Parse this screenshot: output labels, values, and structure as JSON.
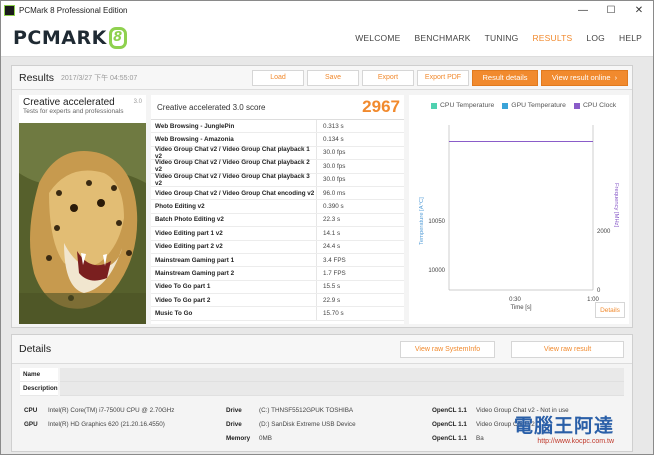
{
  "window": {
    "title": "PCMark 8 Professional Edition",
    "minimize_glyph": "—",
    "maximize_glyph": "☐",
    "close_glyph": "✕"
  },
  "nav": {
    "logo_text": "PCMARK",
    "logo_badge": "8",
    "links": [
      "WELCOME",
      "BENCHMARK",
      "TUNING",
      "RESULTS",
      "LOG",
      "HELP"
    ],
    "active": "RESULTS"
  },
  "results": {
    "heading": "Results",
    "date": "2017/3/27 下午 04:55:07",
    "buttons": {
      "load": "Load",
      "save": "Save",
      "export": "Export",
      "export_pdf": "Export PDF",
      "result_details": "Result details",
      "view_online": "View result online"
    }
  },
  "test": {
    "name": "Creative accelerated",
    "version": "3.0",
    "description": "Tests for experts and professionals"
  },
  "score": {
    "label": "Creative accelerated 3.0 score",
    "value": "2967",
    "rows": [
      {
        "label": "Web Browsing - JunglePin",
        "value": "0.313 s"
      },
      {
        "label": "Web Browsing - Amazonia",
        "value": "0.134 s"
      },
      {
        "label": "Video Group Chat v2 / Video Group Chat playback 1 v2",
        "value": "30.0 fps"
      },
      {
        "label": "Video Group Chat v2 / Video Group Chat playback 2 v2",
        "value": "30.0 fps"
      },
      {
        "label": "Video Group Chat v2 / Video Group Chat playback 3 v2",
        "value": "30.0 fps"
      },
      {
        "label": "Video Group Chat v2 / Video Group Chat encoding v2",
        "value": "96.0 ms"
      },
      {
        "label": "Photo Editing v2",
        "value": "0.390 s"
      },
      {
        "label": "Batch Photo Editing v2",
        "value": "22.3 s"
      },
      {
        "label": "Video Editing part 1 v2",
        "value": "14.1 s"
      },
      {
        "label": "Video Editing part 2 v2",
        "value": "24.4 s"
      },
      {
        "label": "Mainstream Gaming part 1",
        "value": "3.4 FPS"
      },
      {
        "label": "Mainstream Gaming part 2",
        "value": "1.7 FPS"
      },
      {
        "label": "Video To Go part 1",
        "value": "15.5 s"
      },
      {
        "label": "Video To Go part 2",
        "value": "22.9 s"
      },
      {
        "label": "Music To Go",
        "value": "15.70 s"
      }
    ]
  },
  "monitor": {
    "legend": [
      {
        "name": "CPU Temperature",
        "color": "#4fd1b0"
      },
      {
        "name": "GPU Temperature",
        "color": "#3aa3d8"
      },
      {
        "name": "CPU Clock",
        "color": "#8a5cc9"
      }
    ],
    "left_axis_label": "Temperature [A°C]",
    "right_axis_label": "Frequency [MHz]",
    "left_ticks": [
      "10050",
      "10000"
    ],
    "right_ticks": [
      "2000",
      "0"
    ],
    "x_ticks": [
      "0:30",
      "1:00"
    ],
    "x_label": "Time [s]",
    "details_button": "Details"
  },
  "chart_data": {
    "type": "line",
    "x": [
      0,
      60
    ],
    "series": [
      {
        "name": "CPU Clock",
        "values": [
          2700,
          2700
        ]
      }
    ],
    "xlabel": "Time [s]",
    "ylabel": "Temperature [A°C]",
    "y2label": "Frequency [MHz]",
    "ylim": [
      9950,
      10100
    ],
    "y2lim": [
      0,
      3000
    ],
    "xlim": [
      0,
      60
    ],
    "grid": false
  },
  "details": {
    "heading": "Details",
    "view_sysinfo": "View raw SystemInfo",
    "view_result": "View raw result",
    "name_label": "Name",
    "description_label": "Description",
    "cpu_label": "CPU",
    "cpu_value": "Intel(R) Core(TM) i7-7500U CPU @ 2.70GHz",
    "gpu_label": "GPU",
    "gpu_value": "Intel(R) HD Graphics 620 (21.20.16.4550)",
    "drive_label": "Drive",
    "drive1_value": "(C:) THNSF5512GPUK TOSHIBA",
    "drive2_value": "(D:) SanDisk Extreme USB Device",
    "memory_label": "Memory",
    "memory_value": "0MB",
    "opencl_label": "OpenCL 1.1",
    "opencl1_value": "Video Group Chat v2 - Not in use",
    "opencl2_value": "Video Group Chat v2",
    "opencl3_value": "Ba"
  },
  "watermark": {
    "line1": "電腦王阿達",
    "line2": "http://www.kocpc.com.tw"
  }
}
